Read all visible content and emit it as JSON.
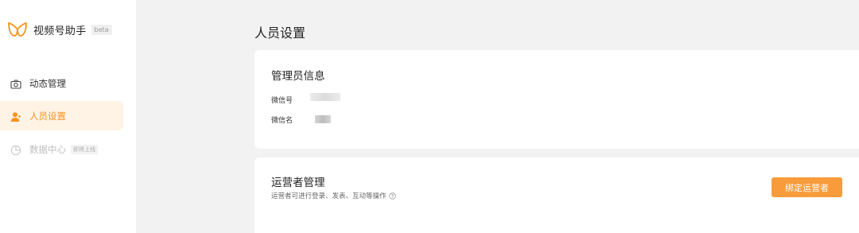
{
  "brand": {
    "name": "视频号助手",
    "badge": "beta",
    "accent": "#f7931e"
  },
  "nav": {
    "items": [
      {
        "label": "动态管理",
        "icon": "camera-icon",
        "active": false
      },
      {
        "label": "人员设置",
        "icon": "user-icon",
        "active": true
      },
      {
        "label": "数据中心",
        "icon": "pie-chart-icon",
        "active": false,
        "badge": "即将上线",
        "disabled": true
      }
    ]
  },
  "page": {
    "title": "人员设置"
  },
  "admin": {
    "title": "管理员信息",
    "wechat_id_label": "微信号",
    "wechat_name_label": "微信名"
  },
  "operators": {
    "title": "运营者管理",
    "description": "运营者可进行登录、发表、互动等操作",
    "bind_button": "绑定运营者",
    "button_color": "#f89c3b"
  }
}
